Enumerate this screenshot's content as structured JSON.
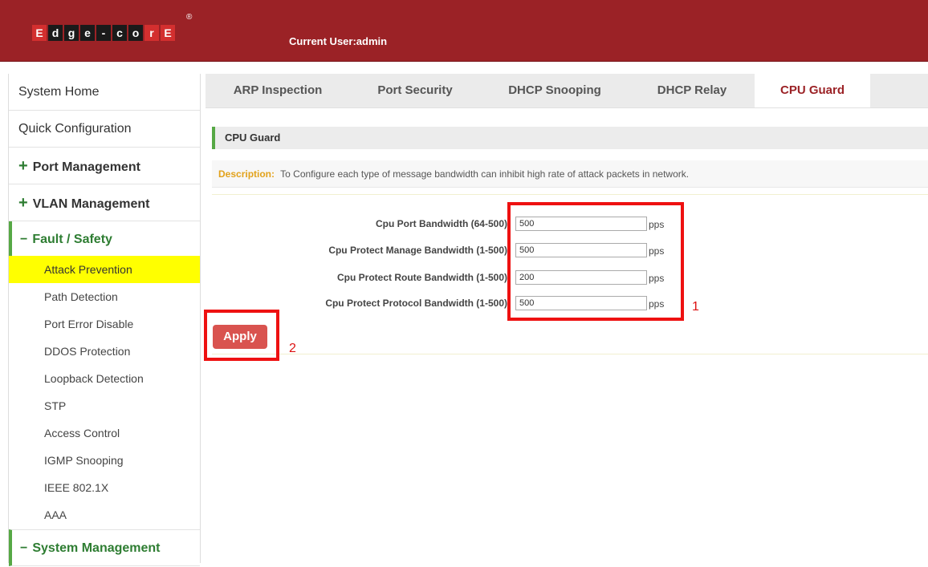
{
  "header": {
    "logo_letters": [
      "E",
      "d",
      "g",
      "e",
      "-",
      "c",
      "o",
      "r",
      "E"
    ],
    "logo_reg": "®",
    "current_user": "Current User:admin"
  },
  "sidebar": {
    "system_home": "System Home",
    "quick_configuration": "Quick Configuration",
    "port_management": "Port Management",
    "vlan_management": "VLAN Management",
    "fault_safety": "Fault / Safety",
    "plus_symbol": "+",
    "minus_symbol": "−",
    "sub_items": [
      "Attack Prevention",
      "Path Detection",
      "Port Error Disable",
      "DDOS Protection",
      "Loopback Detection",
      "STP",
      "Access Control",
      "IGMP Snooping",
      "IEEE 802.1X",
      "AAA"
    ],
    "system_management": "System Management"
  },
  "tabs": [
    {
      "label": "ARP Inspection"
    },
    {
      "label": "Port Security"
    },
    {
      "label": "DHCP Snooping"
    },
    {
      "label": "DHCP Relay"
    },
    {
      "label": "CPU Guard"
    }
  ],
  "section": {
    "title": "CPU Guard",
    "description_label": "Description:",
    "description_text": "To Configure each type of message bandwidth can inhibit high rate of attack packets in network."
  },
  "form": {
    "fields": [
      {
        "label": "Cpu Port Bandwidth (64-500):",
        "value": "500",
        "unit": "pps"
      },
      {
        "label": "Cpu Protect Manage Bandwidth (1-500):",
        "value": "500",
        "unit": "pps"
      },
      {
        "label": "Cpu Protect Route Bandwidth (1-500):",
        "value": "200",
        "unit": "pps"
      },
      {
        "label": "Cpu Protect Protocol Bandwidth (1-500):",
        "value": "500",
        "unit": "pps"
      }
    ],
    "apply_label": "Apply"
  },
  "annotations": {
    "num1": "1",
    "num2": "2"
  },
  "colors": {
    "header_bg": "#9b2226",
    "accent_green": "#56a845",
    "active_yellow": "#ffff00",
    "apply_red": "#d9534f",
    "annotation_red": "#ee1111"
  }
}
